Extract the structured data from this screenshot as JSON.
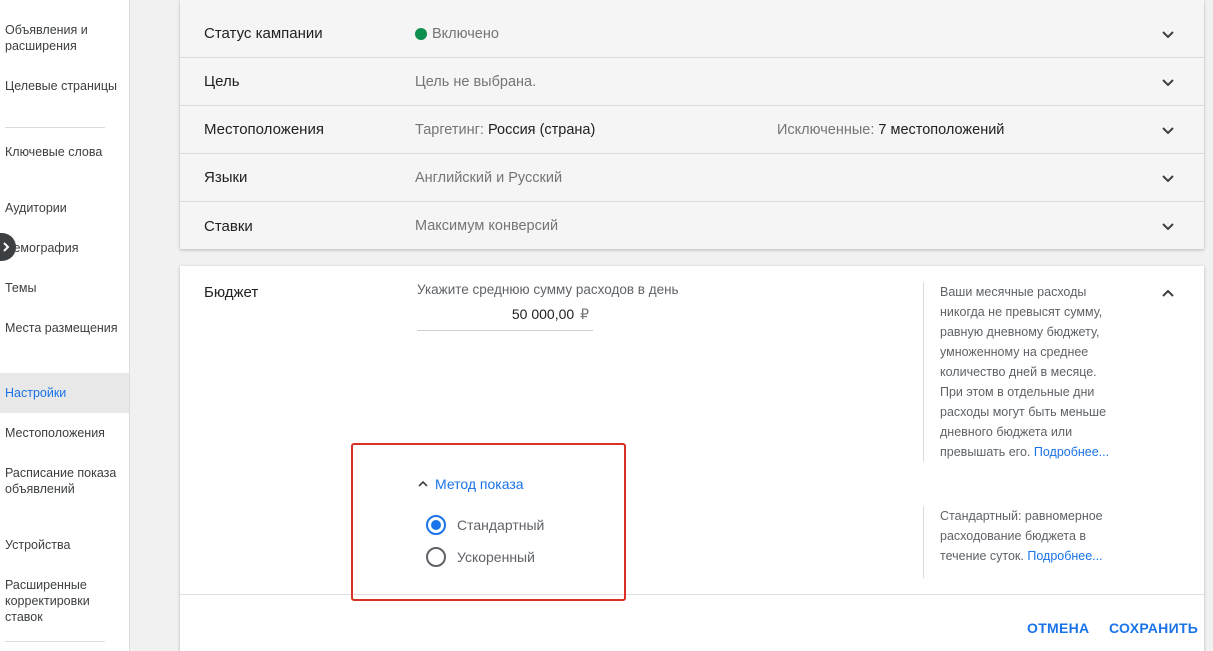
{
  "sidebar": {
    "items": [
      {
        "label": "Объявления и расширения",
        "active": false
      },
      {
        "label": "Целевые страницы",
        "active": false
      },
      {
        "label": "Ключевые слова",
        "active": false
      },
      {
        "label": "Аудитории",
        "active": false
      },
      {
        "label": "Демография",
        "active": false
      },
      {
        "label": "Темы",
        "active": false
      },
      {
        "label": "Места размещения",
        "active": false
      },
      {
        "label": "Настройки",
        "active": true
      },
      {
        "label": "Местоположения",
        "active": false
      },
      {
        "label": "Расписание показа объявлений",
        "active": false
      },
      {
        "label": "Устройства",
        "active": false
      },
      {
        "label": "Расширенные корректировки ставок",
        "active": false
      }
    ],
    "collapse_icon": "chevron-right-icon"
  },
  "settings": {
    "status": {
      "label": "Статус кампании",
      "value": "Включено",
      "status_color": "#0d904f"
    },
    "goal": {
      "label": "Цель",
      "value": "Цель не выбрана."
    },
    "locations": {
      "label": "Местоположения",
      "targeting_label": "Таргетинг:",
      "targeting_value": "Россия (страна)",
      "excluded_label": "Исключенные:",
      "excluded_value": "7 местоположений"
    },
    "languages": {
      "label": "Языки",
      "value": "Английский и Русский"
    },
    "bids": {
      "label": "Ставки",
      "value": "Максимум конверсий"
    }
  },
  "budget": {
    "title": "Бюджет",
    "hint": "Укажите среднюю сумму расходов в день",
    "amount": "50 000,00",
    "currency": "₽",
    "help_text": "Ваши месячные расходы никогда не превысят сумму, равную дневному бюджету, умноженному на среднее количество дней в месяце. При этом в отдельные дни расходы могут быть меньше дневного бюджета или превышать его.",
    "help_link": "Подробнее...",
    "delivery": {
      "toggle_label": "Метод показа",
      "options": [
        {
          "label": "Стандартный",
          "selected": true
        },
        {
          "label": "Ускоренный",
          "selected": false
        }
      ],
      "help_text": "Стандартный: равномерное расходование бюджета в течение суток.",
      "help_link": "Подробнее..."
    },
    "cancel_label": "ОТМЕНА",
    "save_label": "СОХРАНИТЬ"
  },
  "colors": {
    "accent": "#1a73e8",
    "highlight": "#d93025"
  }
}
